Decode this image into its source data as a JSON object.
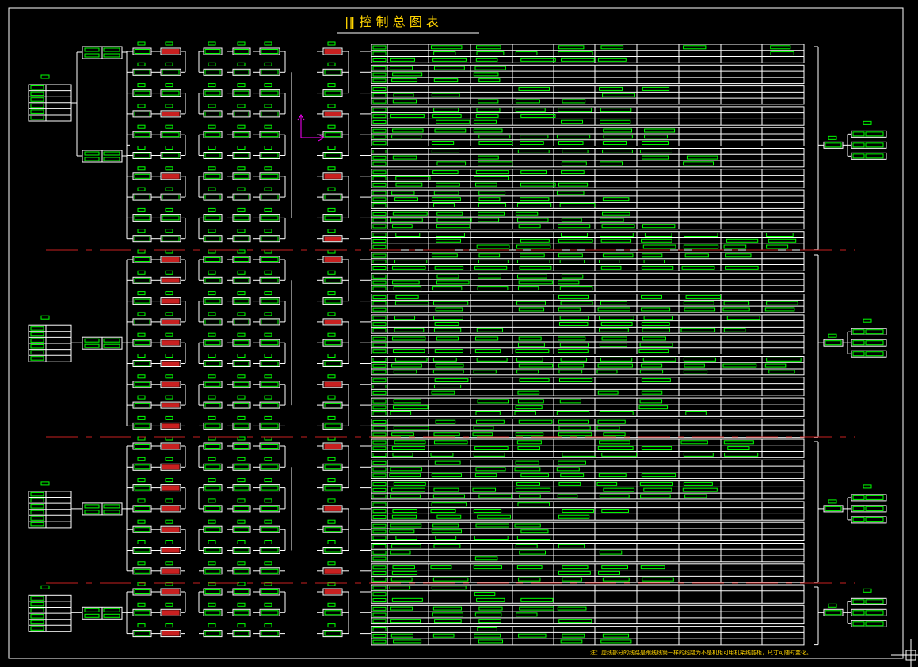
{
  "title": "|‖ 控 制 总 图 表",
  "note": "注：虚线部分的线路是跟线线筒一样的线路为不是机柜可用机架线能柜，尺寸可随时变化。",
  "colors": {
    "background": "#000000",
    "line": "#ffffff",
    "box": "#00ff00",
    "highlight": "#c82020",
    "title": "#ffd400",
    "separator": "#c82020",
    "arrow": "#ff00ff"
  },
  "sections": [
    {
      "id": "A",
      "rows": 10,
      "red_rows": [
        0,
        3,
        6
      ]
    },
    {
      "id": "B",
      "rows": 9,
      "red_rows": [
        0,
        1,
        2,
        3,
        4,
        5,
        6,
        7,
        8
      ]
    },
    {
      "id": "C",
      "rows": 7,
      "red_rows": [
        0,
        1,
        2,
        3,
        4,
        5,
        6
      ]
    },
    {
      "id": "D",
      "rows": 3,
      "red_rows": [
        0,
        1,
        2
      ]
    }
  ]
}
